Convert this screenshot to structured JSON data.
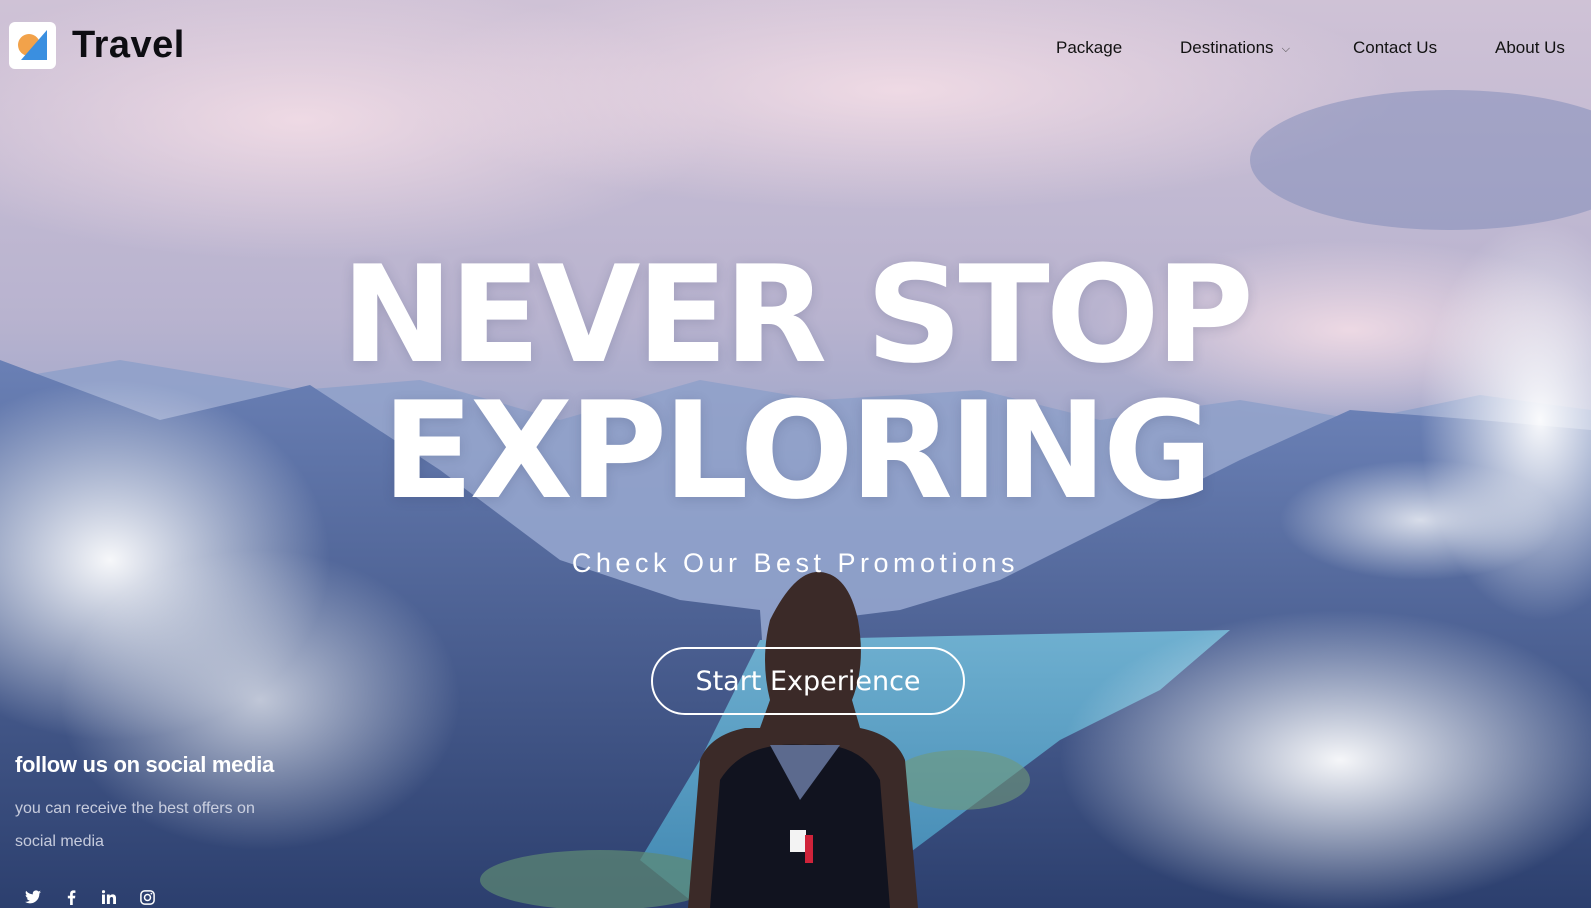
{
  "brand": {
    "name": "Travel",
    "logo_icon": "compass-logo-icon"
  },
  "nav": {
    "items": [
      {
        "label": "Package"
      },
      {
        "label": "Destinations",
        "icon": "chevron-down-icon"
      },
      {
        "label": "Contact Us"
      },
      {
        "label": "About Us"
      }
    ]
  },
  "hero": {
    "title_line1": "NEVER STOP",
    "title_line2": "EXPLORING",
    "subtitle": "Check Our Best Promotions",
    "cta_label": "Start Experience"
  },
  "social": {
    "title": "follow us on social media",
    "description": "you can receive the best offers on social media",
    "icons": [
      "twitter-icon",
      "facebook-icon",
      "linkedin-icon",
      "instagram-icon"
    ]
  },
  "colors": {
    "sky": "#d8c9dd",
    "mountains": "#4d6aa6",
    "lake": "#5fa6c9",
    "text_dark": "#121212",
    "white": "#ffffff"
  }
}
